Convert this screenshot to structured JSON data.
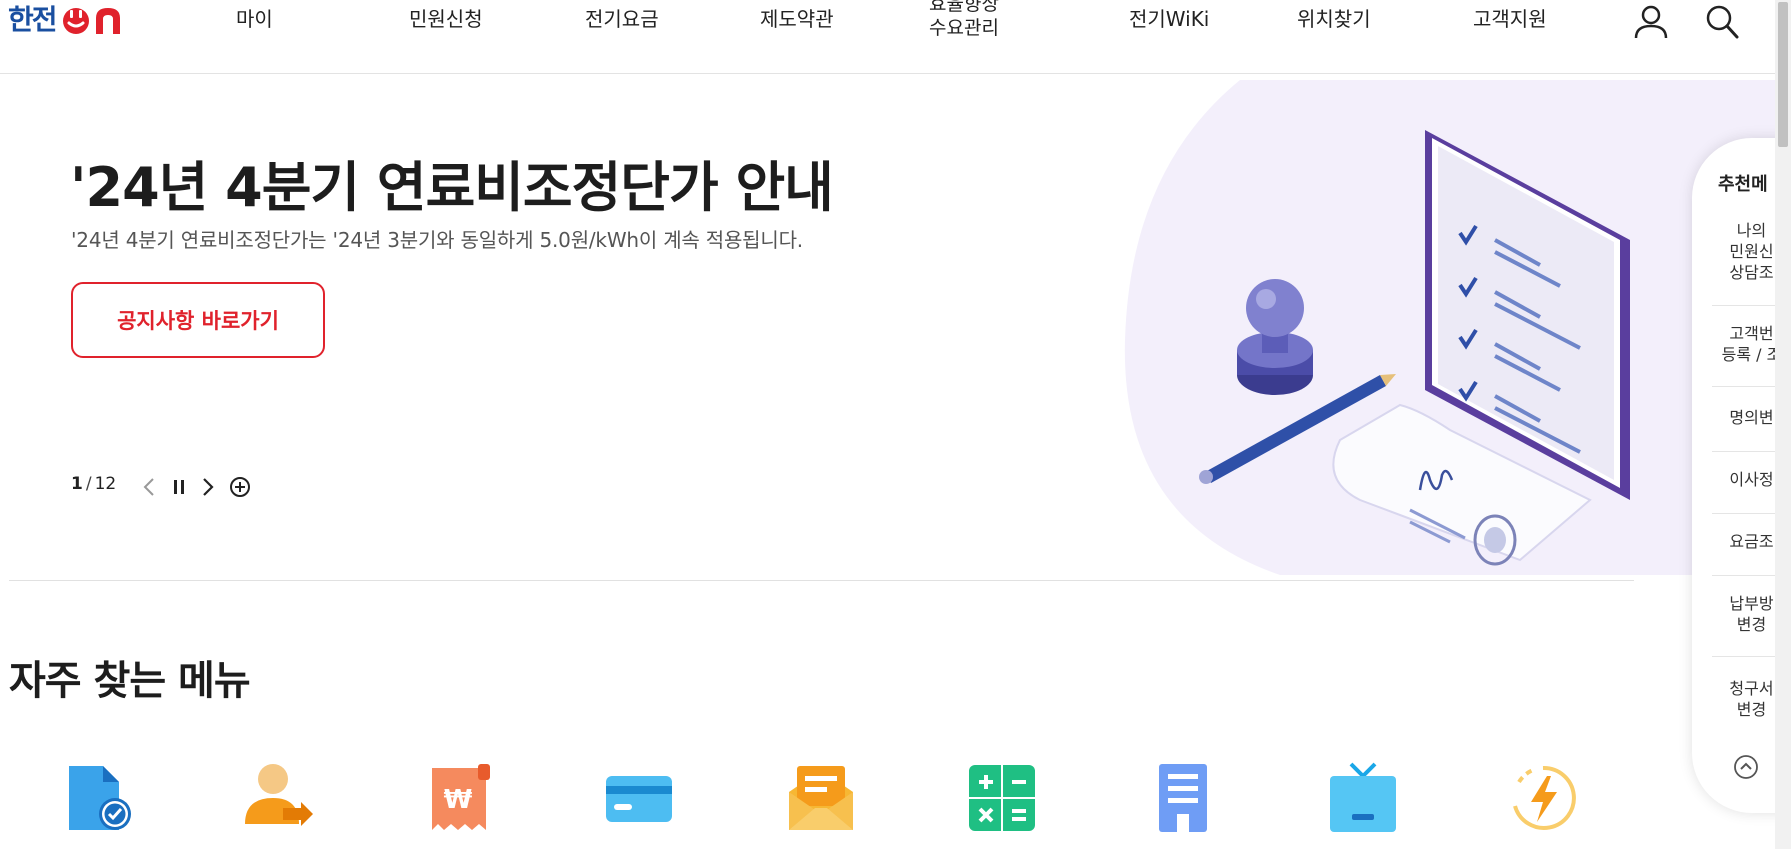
{
  "header": {
    "logo_text": "한전",
    "logo_on": "ON",
    "nav": [
      "마이",
      "민원신청",
      "전기요금",
      "제도약관",
      "효율향상",
      "수요관리",
      "전기WiKi",
      "위치찾기",
      "고객지원"
    ]
  },
  "hero": {
    "title": "'24년 4분기 연료비조정단가 안내",
    "subtitle": "'24년 4분기 연료비조정단가는 '24년 3분기와 동일하게 5.0원/kWh이 계속 적용됩니다.",
    "button_label": "공지사항 바로가기",
    "pager_current": "1",
    "pager_sep": "/",
    "pager_total": "12"
  },
  "section": {
    "title": "자주 찾는 메뉴"
  },
  "quick_panel": {
    "title": "추천메",
    "items": [
      [
        "나의",
        "민원신",
        "상담조"
      ],
      [
        "고객번",
        "등록 / 조"
      ],
      [
        "명의변"
      ],
      [
        "이사정"
      ],
      [
        "요금조"
      ],
      [
        "납부방",
        "변경"
      ],
      [
        "청구서",
        "변경"
      ]
    ]
  },
  "colors": {
    "brand_blue": "#1a4fa0",
    "brand_red": "#e0222c",
    "accent_purple": "#6c4fb3"
  }
}
